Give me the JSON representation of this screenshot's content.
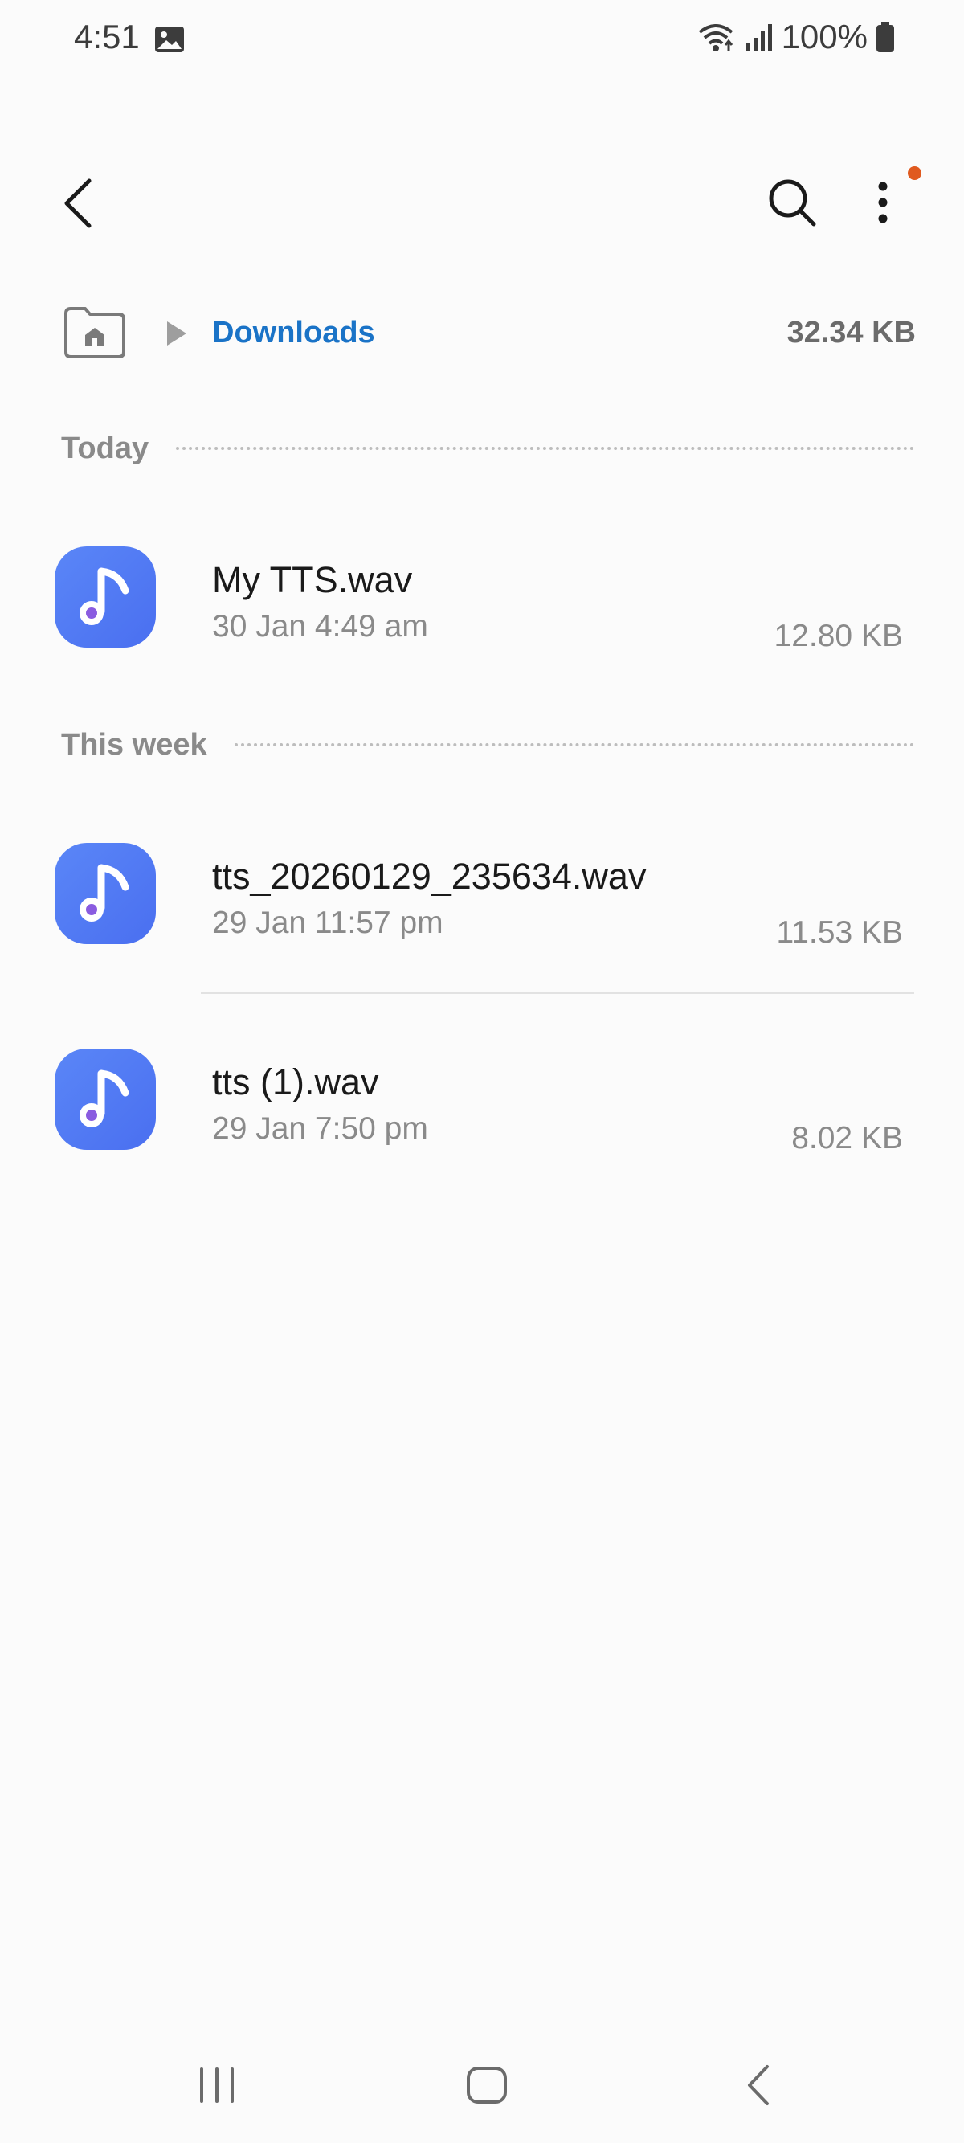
{
  "status_bar": {
    "time": "4:51",
    "battery": "100%",
    "icons": [
      "gallery-icon",
      "wifi-icon",
      "signal-icon",
      "battery-icon"
    ]
  },
  "app_bar": {
    "icons": [
      "back-icon",
      "search-icon",
      "more-vert-icon"
    ],
    "notification_dot_color": "#e05a1f"
  },
  "path_bar": {
    "current_folder": "Downloads",
    "total_size": "32.34 KB",
    "link_color": "#1a73c7"
  },
  "sections": [
    {
      "title": "Today",
      "files": [
        {
          "name": "My TTS.wav",
          "date": "30 Jan 4:49 am",
          "size": "12.80 KB",
          "icon": "music-note-icon"
        }
      ]
    },
    {
      "title": "This week",
      "files": [
        {
          "name": "tts_20260129_235634.wav",
          "date": "29 Jan 11:57 pm",
          "size": "11.53 KB",
          "icon": "music-note-icon"
        },
        {
          "name": "tts (1).wav",
          "date": "29 Jan 7:50 pm",
          "size": "8.02 KB",
          "icon": "music-note-icon"
        }
      ]
    }
  ],
  "nav_bar": {
    "icons": [
      "recent-apps-icon",
      "home-icon",
      "back-icon"
    ]
  }
}
